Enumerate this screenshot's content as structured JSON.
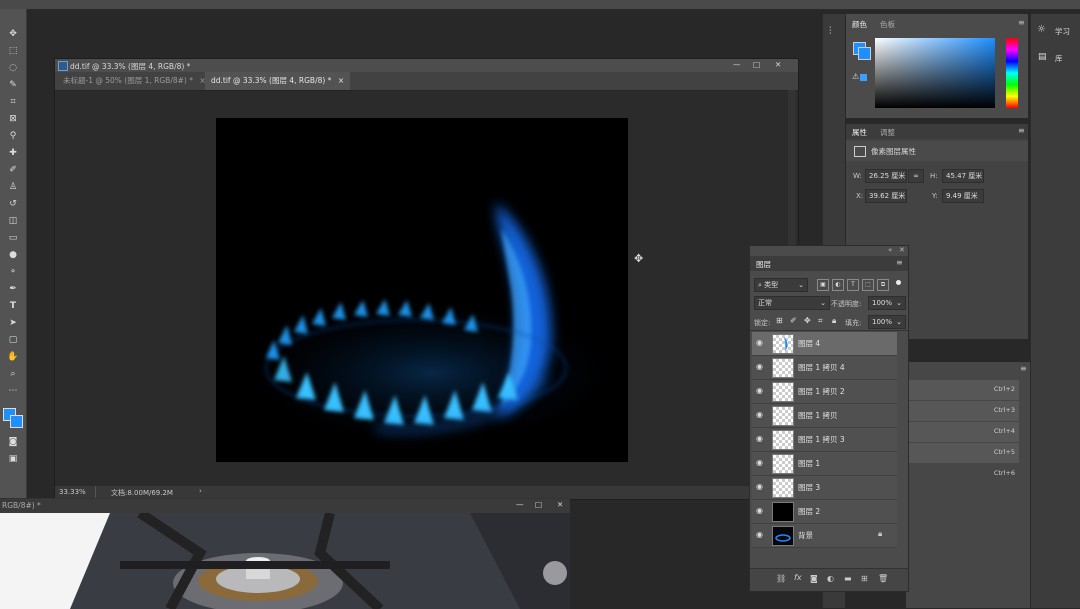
{
  "doc_window": {
    "title": "dd.tif @ 33.3% (图层 4, RGB/8) *",
    "tabs": [
      {
        "label": "未标题-1 @ 50% (图层 1, RGB/8#) *",
        "close": "×"
      },
      {
        "label": "dd.tif @ 33.3% (图层 4, RGB/8) *",
        "close": "×"
      }
    ],
    "controls": {
      "minimize": "—",
      "maximize": "□",
      "close": "✕"
    },
    "status": {
      "zoom": "33.33%",
      "doc_size": "文档:8.00M/69.2M",
      "arrow": "›"
    }
  },
  "color_panel": {
    "tabs": [
      "颜色",
      "色板"
    ]
  },
  "properties_panel": {
    "tabs": [
      "属性",
      "调整"
    ],
    "heading": "像素图层属性",
    "w_label": "W:",
    "w_value": "26.25 厘米",
    "h_label": "H:",
    "h_value": "45.47 厘米",
    "x_label": "X:",
    "x_value": "39.62 厘米",
    "y_label": "Y:",
    "y_value": "9.49 厘米",
    "link": "∞"
  },
  "right_strip": {
    "learn": "学习",
    "library": "库"
  },
  "shortcuts": [
    "Ctrl+2",
    "Ctrl+3",
    "Ctrl+4",
    "Ctrl+5",
    "Ctrl+6"
  ],
  "layers_panel": {
    "title": "图层",
    "filter_label": "类型",
    "blend_mode": "正常",
    "opacity_label": "不透明度:",
    "opacity_value": "100%",
    "lock_label": "锁定:",
    "fill_label": "填充:",
    "fill_value": "100%",
    "layers": [
      {
        "name": "图层 4",
        "selected": true
      },
      {
        "name": "图层 1 拷贝 4"
      },
      {
        "name": "图层 1 拷贝 2"
      },
      {
        "name": "图层 1 拷贝"
      },
      {
        "name": "图层 1 拷贝 3"
      },
      {
        "name": "图层 1"
      },
      {
        "name": "图层 3"
      },
      {
        "name": "图层 2"
      },
      {
        "name": "背景",
        "locked": true
      }
    ],
    "footer_icons": [
      "link-icon",
      "fx-icon",
      "mask-icon",
      "adjustment-icon",
      "group-icon",
      "new-layer-icon",
      "trash-icon"
    ]
  },
  "doc2": {
    "title": "RGB/8#) *"
  },
  "colors": {
    "flame_blue": "#1a8cff",
    "foreground_swatch": "#1e8fff",
    "panel": "#4b4b4b"
  }
}
